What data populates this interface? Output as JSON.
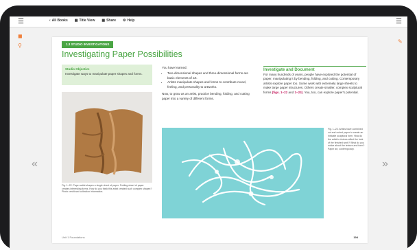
{
  "toolbar": {
    "items": [
      {
        "icon": "back-arrow-icon",
        "label": "All Books"
      },
      {
        "icon": "grid-icon",
        "label": "Title View"
      },
      {
        "icon": "share-icon",
        "label": "Share"
      },
      {
        "icon": "help-icon",
        "label": "Help"
      }
    ]
  },
  "page": {
    "unit_banner": "1.3 STUDIO INVESTIGATIONS",
    "title": "Investigating Paper Possibilities",
    "objective_heading": "Studio Objective",
    "objective_text": "Investigate ways to manipulate paper shapes and forms.",
    "learned_intro": "You have learned:",
    "bullets": [
      "Two-dimensional shapes and three-dimensional forms are basic elements of art.",
      "Artists manipulate shapes and forms to contribute mood, feeling, and personality to artworks."
    ],
    "practice_text": "Now, to grow as an artist, practice bending, folding, and cutting paper into a variety of different forms.",
    "investigate_heading": "Investigate and Document",
    "investigate_text": "For many hundreds of years, people have explored the potential of paper, manipulating it by bending, folding, and cutting. Contemporary artists explore paper too. Some work with extremely large sheets to make large paper structures. Others create smaller, complex sculptural forms",
    "ref1": "(figs. 1–22",
    "ref_join": " and ",
    "ref2": "1–23)",
    "investigate_end": ". You, too, can explore paper's potential.",
    "photo_caption": "Fig. 1–22. Paper artist shapes a single sheet of paper. Folding sheet of paper creates interesting forms. How do you think this artist created such complex shapes?",
    "photo_credit": "Photo credit and collection information.",
    "sculpture_caption": "Fig. 1–23. Artists have combined cut and curled paper to create an intricate sculptural form. How do the artist's choices affect the look of the finished work? What do you notice about the texture and form?",
    "sculpture_credit": "Paper art, contemporary.",
    "footer_left": "Unit 1  Foundations",
    "page_number": "194"
  }
}
